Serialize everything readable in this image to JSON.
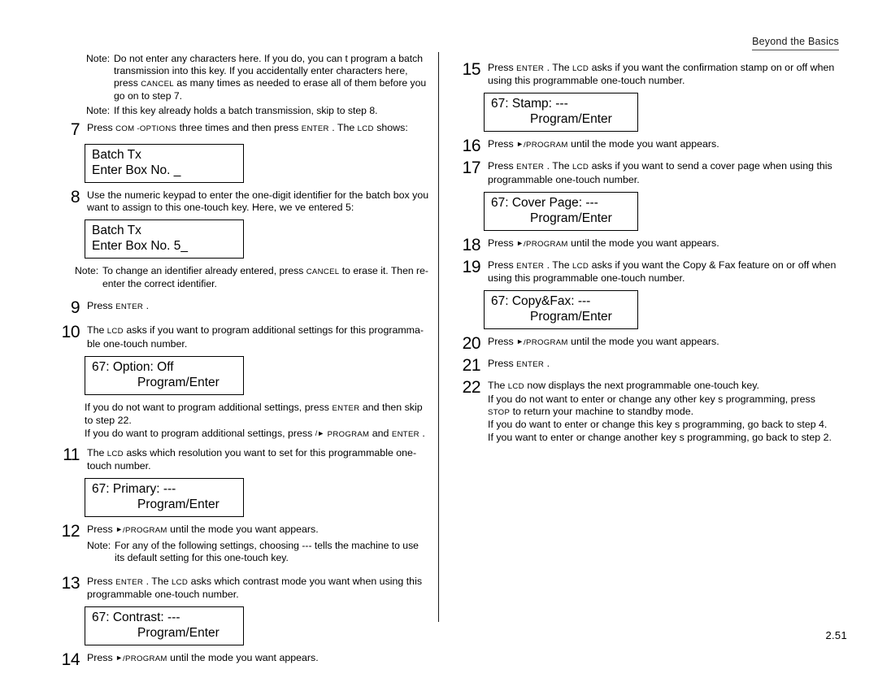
{
  "header": {
    "running_head": "Beyond the Basics"
  },
  "footer": {
    "page_number": "2.51"
  },
  "keys": {
    "enter": "ENTER",
    "cancel": "CANCEL",
    "com_options": "COM -OPTIONS",
    "program": "PROGRAM",
    "stop": "STOP"
  },
  "left_column": {
    "top_notes": [
      {
        "label": "Note:",
        "text_a": "Do not    enter any characters here. If you do, you can t program a batch transmission into this key. If you accidentally enter characters here, press ",
        "key": "CANCEL",
        "text_b": " as many times as needed to erase  all  of them before   you go on to step 7."
      },
      {
        "label": "Note:",
        "text_a": "If this key already holds a batch transmission, skip to step 8.",
        "key": "",
        "text_b": ""
      }
    ],
    "steps": [
      {
        "num": "7",
        "text_a": "Press ",
        "key1": "COM -OPTIONS",
        "text_b": " three times and then press ",
        "key2": "ENTER",
        "text_c": " . The ",
        "key3": "LCD",
        "text_d": " shows:",
        "lcd": {
          "line1": "Batch Tx",
          "line2": "Enter Box No.     _"
        }
      },
      {
        "num": "8",
        "text": "Use the numeric keypad to enter the one-digit identifier for the batch box you want to assign to this one-touch key. Here, we ve entered    5:",
        "lcd": {
          "line1": "Batch Tx",
          "line2": "Enter Box No.    5_"
        },
        "note": {
          "label": "Note:",
          "text_a": "To change an identifier already entered, press   ",
          "key": "CANCEL",
          "text_b": "  to erase it. Then re-enter the correct identifier."
        }
      },
      {
        "num": "9",
        "text_a": "Press ",
        "key1": "ENTER",
        "text_b": " ."
      },
      {
        "num": "10",
        "text_a": "The ",
        "key1": "LCD",
        "text_b": " asks if you want to program additional settings for this programma-ble one-touch number.",
        "lcd": {
          "line1": "67: Option:     Off",
          "line2": "Program/Enter"
        },
        "after_1a": "If you  do not want to program additional settings, press    ",
        "after_1key": "ENTER",
        "after_1b": "  and then skip to step 22.",
        "after_2a": "If you  do want to program additional settings, press    ",
        "after_2key": "PROGRAM",
        "after_2b": " and ",
        "after_2key2": "ENTER",
        "after_2c": " ."
      },
      {
        "num": "11",
        "text_a": "The ",
        "key1": "LCD",
        "text_b": " asks which resolution you want to set for this programmable one-touch number.",
        "lcd": {
          "line1": "67: Primary: ---",
          "line2": "Program/Enter"
        }
      },
      {
        "num": "12",
        "text_a": "Press ",
        "key_arrow": "►",
        "key1": "/PROGRAM",
        "text_b": "  until the mode you want appears.",
        "note": {
          "label": "Note:",
          "text_a": "For any of the following settings, choosing  ---  tells the machine to use its default  setting for this one-touch key."
        }
      },
      {
        "num": "13",
        "text_a": "Press ",
        "key1": "ENTER",
        "text_b": " . The ",
        "key2": "LCD",
        "text_c": " asks which contrast mode you want when using this programmable one-touch number.",
        "lcd": {
          "line1": "67: Contrast: ---",
          "line2": "Program/Enter"
        }
      },
      {
        "num": "14",
        "text_a": "Press ",
        "key_arrow": "►",
        "key1": "/PROGRAM",
        "text_b": "  until the mode you want appears."
      }
    ]
  },
  "right_column": {
    "steps": [
      {
        "num": "15",
        "text_a": "Press ",
        "key1": "ENTER",
        "text_b": " . The ",
        "key2": "LCD",
        "text_c": " asks if you want the confirmation stamp on or off when using this programmable one-touch number.",
        "lcd": {
          "line1": "67: Stamp: ---",
          "line2": "Program/Enter"
        }
      },
      {
        "num": "16",
        "text_a": "Press ",
        "key_arrow": "►",
        "key1": "/PROGRAM",
        "text_b": "  until the mode you want appears."
      },
      {
        "num": "17",
        "text_a": "Press ",
        "key1": "ENTER",
        "text_b": " . The ",
        "key2": "LCD",
        "text_c": " asks if you want to send a cover page when using this programmable one-touch number.",
        "lcd": {
          "line1": "67: Cover Page: ---",
          "line2": "Program/Enter"
        }
      },
      {
        "num": "18",
        "text_a": "Press ",
        "key_arrow": "►",
        "key1": "/PROGRAM",
        "text_b": "  until the mode you want appears."
      },
      {
        "num": "19",
        "text_a": "Press ",
        "key1": "ENTER",
        "text_b": " . The ",
        "key2": "LCD",
        "text_c": " asks if you want the Copy & Fax feature on or off when using this programmable one-touch number.",
        "lcd": {
          "line1": "67: Copy&Fax: ---",
          "line2": "Program/Enter"
        }
      },
      {
        "num": "20",
        "text_a": "Press ",
        "key_arrow": "►",
        "key1": "/PROGRAM",
        "text_b": "  until the mode you want appears."
      },
      {
        "num": "21",
        "text_a": "Press ",
        "key1": "ENTER",
        "text_b": " ."
      },
      {
        "num": "22",
        "line1_a": "The ",
        "line1_key": "LCD",
        "line1_b": " now displays the next programmable one-touch key.",
        "line2_a": "If you  do not want to enter or change  any other  key s programming, press  ",
        "line2_key": "STOP",
        "line2_b": " to return your machine to standby mode.",
        "line3": "If you  do want to enter or change this key s programming, go back to step 4.",
        "line4": "If you want to enter or change   another  key s programming, go back to step 2."
      }
    ]
  }
}
